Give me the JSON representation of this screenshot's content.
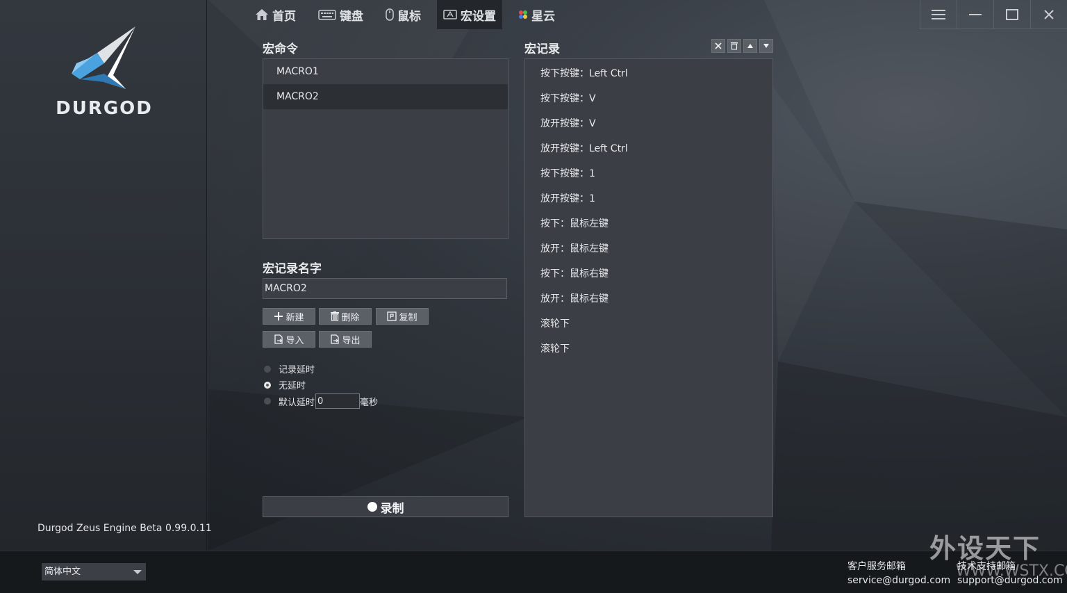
{
  "app": {
    "brand": "DURGOD",
    "version": "Durgod Zeus Engine Beta 0.99.0.11"
  },
  "nav": [
    {
      "label": "首页",
      "icon": "home-icon"
    },
    {
      "label": "键盘",
      "icon": "keyboard-icon"
    },
    {
      "label": "鼠标",
      "icon": "mouse-icon"
    },
    {
      "label": "宏设置",
      "icon": "macro-icon",
      "active": true
    },
    {
      "label": "星云",
      "icon": "nebula-icon"
    }
  ],
  "window_controls": {
    "menu": "menu-icon",
    "minimize": "minimize-icon",
    "maximize": "maximize-icon",
    "close": "close-icon"
  },
  "macro_commands": {
    "title": "宏命令",
    "items": [
      "MACRO1",
      "MACRO2"
    ],
    "selected": "MACRO2"
  },
  "macro_name": {
    "title": "宏记录名字",
    "value": "MACRO2"
  },
  "buttons": {
    "new": "新建",
    "delete": "删除",
    "copy": "复制",
    "import": "导入",
    "export": "导出",
    "record": "录制"
  },
  "delay_options": {
    "record_delay": "记录延时",
    "no_delay": "无延时",
    "default_delay": "默认延时",
    "default_delay_value": "0",
    "unit": "毫秒",
    "selected": "no_delay"
  },
  "macro_record": {
    "title": "宏记录",
    "events": [
      "按下按键：Left Ctrl",
      "按下按键：V",
      "放开按键：V",
      "放开按键：Left Ctrl",
      "按下按键：1",
      "放开按键：1",
      "按下：鼠标左键",
      "放开：鼠标左键",
      "按下：鼠标右键",
      "放开：鼠标右键",
      "滚轮下",
      "滚轮下"
    ]
  },
  "footer": {
    "language": "简体中文",
    "service_label": "客户服务邮箱",
    "service_email": "service@durgod.com",
    "support_label": "技术支持邮箱",
    "support_email": "support@durgod.com"
  },
  "watermark": {
    "line1": "外设天下",
    "line2": "WWW.WSTX.COM"
  },
  "colors": {
    "accent_blue": "#4aa3df",
    "panel": "#3b3f45",
    "button": "#5b6067"
  }
}
